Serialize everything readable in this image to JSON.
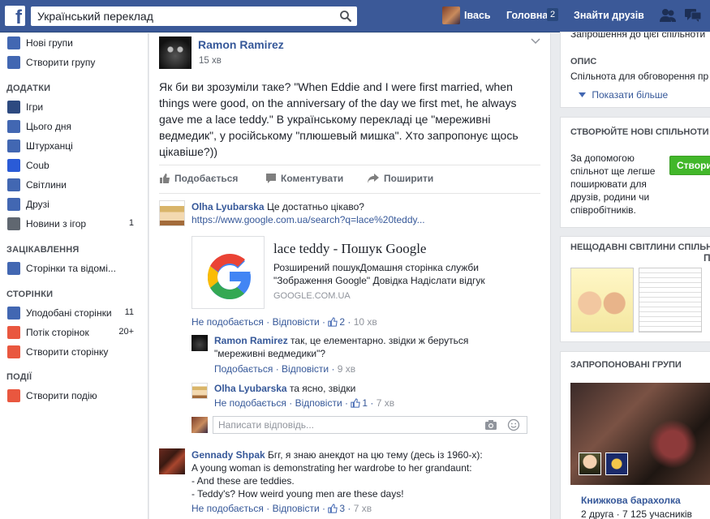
{
  "topbar": {
    "search_value": "Український переклад",
    "user_name": "Івась",
    "home_label": "Головна",
    "home_count": "2",
    "find_friends_label": "Знайти друзів"
  },
  "sidebar": {
    "items_top": [
      {
        "label": "Нові групи",
        "icon": "groups-icon",
        "color": "#4267b2"
      },
      {
        "label": "Створити групу",
        "icon": "plus-icon",
        "color": "#4267b2"
      }
    ],
    "apps_heading": "ДОДАТКИ",
    "apps": [
      {
        "label": "Ігри",
        "icon": "games-icon",
        "color": "#2d4a80",
        "count": ""
      },
      {
        "label": "Цього дня",
        "icon": "clock-icon",
        "color": "#4267b2",
        "count": ""
      },
      {
        "label": "Штурханці",
        "icon": "poke-icon",
        "color": "#4267b2",
        "count": ""
      },
      {
        "label": "Coub",
        "icon": "coub-icon",
        "color": "#2a5bd7",
        "count": ""
      },
      {
        "label": "Світлини",
        "icon": "photos-icon",
        "color": "#4267b2",
        "count": ""
      },
      {
        "label": "Друзі",
        "icon": "friends-icon",
        "color": "#4267b2",
        "count": ""
      },
      {
        "label": "Новини з ігор",
        "icon": "gamepad-icon",
        "color": "#606770",
        "count": "1"
      }
    ],
    "interests_heading": "ЗАЦІКАВЛЕННЯ",
    "interests": [
      {
        "label": "Сторінки та відомі...",
        "icon": "pages-feed-icon",
        "color": "#4267b2"
      }
    ],
    "pages_heading": "СТОРІНКИ",
    "pages": [
      {
        "label": "Уподобані сторінки",
        "icon": "liked-pages-icon",
        "color": "#4267b2",
        "count": "11"
      },
      {
        "label": "Потік сторінок",
        "icon": "flag-icon",
        "color": "#e9573f",
        "count": "20+"
      },
      {
        "label": "Створити сторінку",
        "icon": "create-page-icon",
        "color": "#e9573f",
        "count": ""
      }
    ],
    "events_heading": "ПОДІЇ",
    "events": [
      {
        "label": "Створити подію",
        "icon": "create-event-icon",
        "color": "#e9573f"
      }
    ]
  },
  "post": {
    "author": "Ramon Ramirez",
    "time": "15 хв",
    "text": "Як би ви зрозуміли таке? \"When Eddie and I were first married, when things were good, on the anniversary of the day we first met, he always gave me a lace teddy.\" В українському перекладі це \"мереживні ведмедик\", у російському \"плюшевый мишка\". Хто запропонує щось цікавіше?))",
    "like_label": "Подобається",
    "comment_label": "Коментувати",
    "share_label": "Поширити"
  },
  "comments": [
    {
      "author": "Olha Lyubarska",
      "text": "Це достатньо цікаво?",
      "link": "https://www.google.com.ua/search?q=lace%20teddy...",
      "unlike": "Не подобається",
      "reply": "Відповісти",
      "likes": "2",
      "time": "10 хв"
    }
  ],
  "preview": {
    "title": "lace teddy - Пошук Google",
    "description": "Розширений пошукДомашня сторінка служби \"Зображення Google\" Довідка Надіслати відгук",
    "domain": "GOOGLE.COM.UA"
  },
  "replies": [
    {
      "author": "Ramon Ramirez",
      "text": "так, це елементарно. звідки ж беруться \"мереживні ведмедики\"?",
      "unlike": "Подобається",
      "reply": "Відповісти",
      "likes": "",
      "time": "9 хв"
    },
    {
      "author": "Olha Lyubarska",
      "text": "та ясно, звідки",
      "unlike": "Не подобається",
      "reply": "Відповісти",
      "likes": "1",
      "time": "7 хв"
    }
  ],
  "reply_placeholder": "Написати відповідь...",
  "comment2": {
    "author": "Gennady Shpak",
    "text": "Бгг, я знаю анекдот на цю тему (десь із 1960-х):",
    "lines": [
      "A young woman is demonstrating her wardrobe to her grandaunt:",
      "- And these are teddies.",
      "- Teddy's? How weird young men are these days!"
    ],
    "unlike": "Не подобається",
    "reply": "Відповісти",
    "likes": "3",
    "time": "7 хв"
  },
  "right": {
    "top_cut": "Запрошення до цієї спільноти",
    "about_heading": "ОПИС",
    "about_text": "Спільнота для обговорення пр",
    "show_more": "Показати більше",
    "create_heading": "СТВОРЮЙТЕ НОВІ СПІЛЬНОТИ",
    "create_lines": [
      "За допомогою",
      "спільнот ще легше",
      "поширювати для",
      "друзів, родини чи",
      "співробітників."
    ],
    "create_button": "Створи",
    "recent_heading": "НЕЩОДАВНІ СВІТЛИНИ СПІЛЬНО",
    "suggested_heading": "ЗАПРОПОНОВАНІ ГРУПИ",
    "group_name": "Книжкова барахолка",
    "group_meta": "2 друга · 7 125 учасників"
  }
}
